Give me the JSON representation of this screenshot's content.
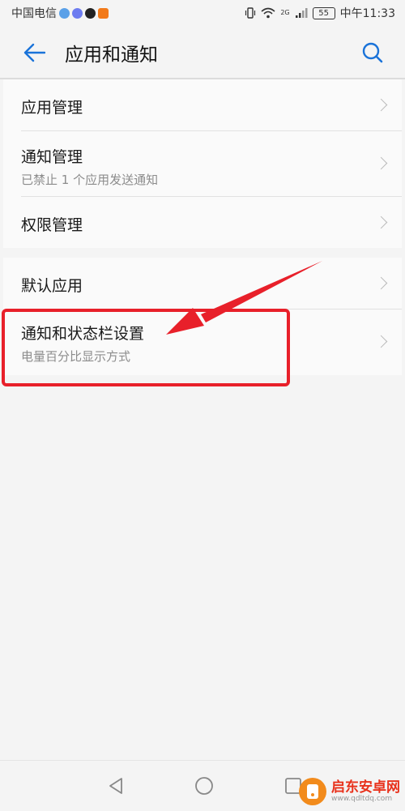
{
  "status_bar": {
    "carrier": "中国电信",
    "network": "2G",
    "battery": "55",
    "time": "中午11:33"
  },
  "header": {
    "title": "应用和通知"
  },
  "group1": [
    {
      "title": "应用管理",
      "subtitle": ""
    },
    {
      "title": "通知管理",
      "subtitle": "已禁止 1 个应用发送通知"
    },
    {
      "title": "权限管理",
      "subtitle": ""
    }
  ],
  "group2": [
    {
      "title": "默认应用",
      "subtitle": ""
    },
    {
      "title": "通知和状态栏设置",
      "subtitle": "电量百分比显示方式"
    }
  ],
  "watermark": {
    "name": "启东安卓网",
    "url": "www.qdltdq.com"
  },
  "colors": {
    "accent": "#1a73d9",
    "annotation": "#e8202a"
  }
}
